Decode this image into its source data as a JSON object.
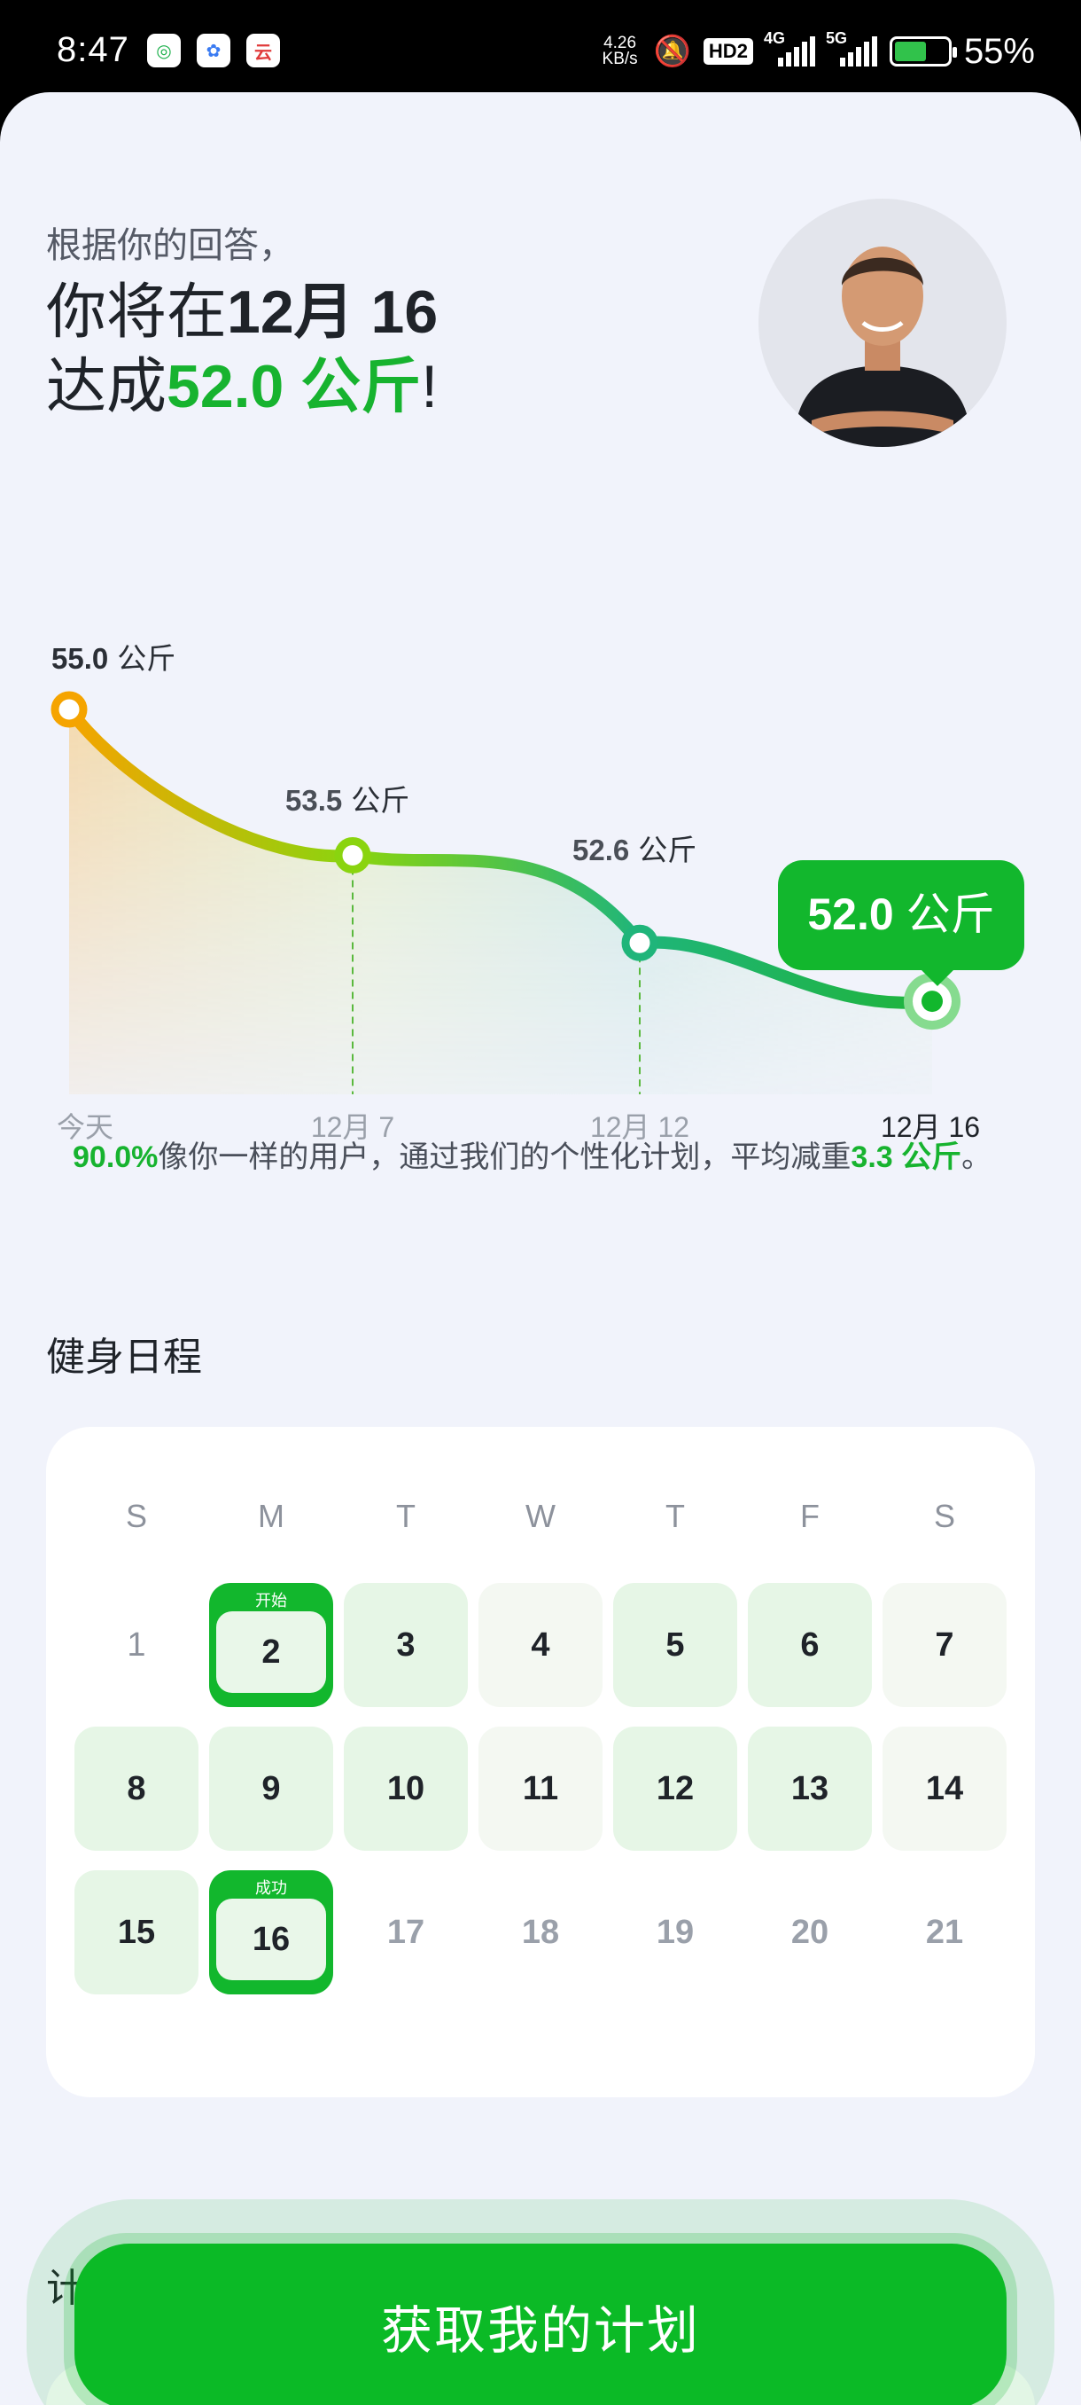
{
  "status_bar": {
    "time": "8:47",
    "app_icons": [
      "app-icon-1",
      "app-icon-2",
      "app-icon-3"
    ],
    "net_speed_value": "4.26",
    "net_speed_unit": "KB/s",
    "hd_badge": "HD2",
    "signal1_label": "4G",
    "signal2_label": "5G",
    "battery": "55%"
  },
  "header": {
    "intro": "根据你的回答，",
    "line1_prefix": "你将在",
    "line1_date": "12月 16",
    "line2_prefix": "达成",
    "line2_weight": "52.0 公斤",
    "line2_suffix": "!"
  },
  "chart_data": {
    "type": "line",
    "x": [
      "今天",
      "12月 7",
      "12月 12",
      "12月 16"
    ],
    "values": [
      55.0,
      53.5,
      52.6,
      52.0
    ],
    "point_labels": [
      "55.0 公斤",
      "53.5 公斤",
      "52.6 公斤",
      "52.0 公斤"
    ],
    "colors": [
      "#f5a400",
      "#8ad40f",
      "#1fb57a",
      "#1fb43b"
    ]
  },
  "stat": {
    "percent": "90.0%",
    "text": "像你一样的用户，通过我们的个性化计划，平均减重",
    "amount": "3.3 公斤",
    "end": "。"
  },
  "schedule": {
    "title": "健身日程",
    "weekdays": [
      "S",
      "M",
      "T",
      "W",
      "T",
      "F",
      "S"
    ],
    "start_tag": "开始",
    "success_tag": "成功",
    "days": [
      {
        "d": "1",
        "s": "none"
      },
      {
        "d": "2",
        "s": "start"
      },
      {
        "d": "3",
        "s": "green"
      },
      {
        "d": "4",
        "s": "light"
      },
      {
        "d": "5",
        "s": "green"
      },
      {
        "d": "6",
        "s": "green"
      },
      {
        "d": "7",
        "s": "light"
      },
      {
        "d": "8",
        "s": "green"
      },
      {
        "d": "9",
        "s": "green"
      },
      {
        "d": "10",
        "s": "green"
      },
      {
        "d": "11",
        "s": "light"
      },
      {
        "d": "12",
        "s": "green"
      },
      {
        "d": "13",
        "s": "green"
      },
      {
        "d": "14",
        "s": "light"
      },
      {
        "d": "15",
        "s": "green"
      },
      {
        "d": "16",
        "s": "success"
      },
      {
        "d": "17",
        "s": "plain"
      },
      {
        "d": "18",
        "s": "plain"
      },
      {
        "d": "19",
        "s": "plain"
      },
      {
        "d": "20",
        "s": "plain"
      },
      {
        "d": "21",
        "s": "plain"
      }
    ]
  },
  "plan_peek": "计",
  "cta": {
    "label": "获取我的计划"
  }
}
